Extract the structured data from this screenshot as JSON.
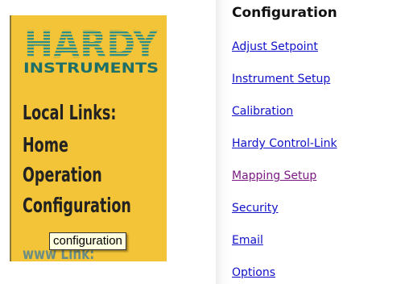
{
  "sidebar": {
    "logo": {
      "word1": "HARDY",
      "word2": "INSTRUMENTS"
    },
    "local_links_title": "Local Links:",
    "links": [
      "Home",
      "Operation",
      "Configuration"
    ],
    "www_link": "www Link:",
    "tooltip": "configuration"
  },
  "main": {
    "title": "Configuration",
    "links": [
      "Adjust Setpoint",
      "Instrument Setup",
      "Calibration",
      "Hardy Control-Link",
      "Mapping Setup",
      "Security",
      "Email",
      "Options"
    ],
    "visited_link": "Mapping Setup"
  },
  "colors": {
    "sidebar_bg": "#f3c437",
    "logo_teal": "#2f8f86",
    "link_blue": "#1010c8",
    "link_visited": "#7a1a82"
  }
}
